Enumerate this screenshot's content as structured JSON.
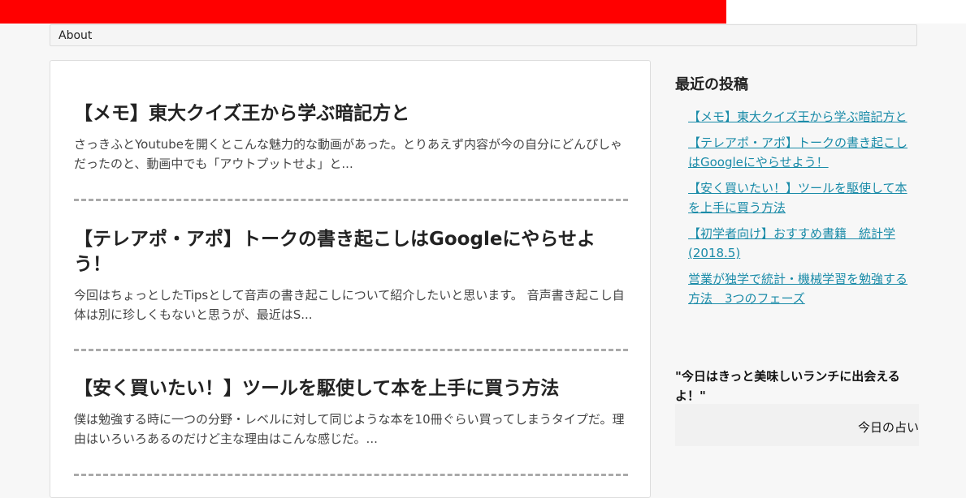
{
  "nav": {
    "items": [
      {
        "label": "About"
      }
    ]
  },
  "posts": [
    {
      "title": "【メモ】東大クイズ王から学ぶ暗記方と",
      "excerpt": "さっきふとYoutubeを開くとこんな魅力的な動画があった。とりあえず内容が今の自分にどんぴしゃだったのと、動画中でも「アウトプットせよ」と..."
    },
    {
      "title": "【テレアポ・アポ】トークの書き起こしはGoogleにやらせよう！",
      "excerpt": "今回はちょっとしたTipsとして音声の書き起こしについて紹介したいと思います。 音声書き起こし自体は別に珍しくもないと思うが、最近はS..."
    },
    {
      "title": "【安く買いたい！】ツールを駆使して本を上手に買う方法",
      "excerpt": "僕は勉強する時に一つの分野・レベルに対して同じような本を10冊ぐらい買ってしまうタイプだ。理由はいろいろあるのだけど主な理由はこんな感じだ。..."
    }
  ],
  "sidebar": {
    "recent_heading": "最近の投稿",
    "recent_posts": [
      {
        "label": "【メモ】東大クイズ王から学ぶ暗記方と"
      },
      {
        "label": "【テレアポ・アポ】トークの書き起こしはGoogleにやらせよう！"
      },
      {
        "label": "【安く買いたい！】ツールを駆使して本を上手に買う方法"
      },
      {
        "label": "【初学者向け】おすすめ書籍　統計学(2018.5)"
      },
      {
        "label": "営業が独学で統計・機械学習を勉強する方法　3つのフェーズ"
      }
    ],
    "fortune_quote": "\"今日はきっと美味しいランチに出会えるよ！\"",
    "fortune_label": "今日の占い"
  },
  "colors": {
    "top_bar": "#ff0000",
    "link": "#1a8ba8"
  }
}
